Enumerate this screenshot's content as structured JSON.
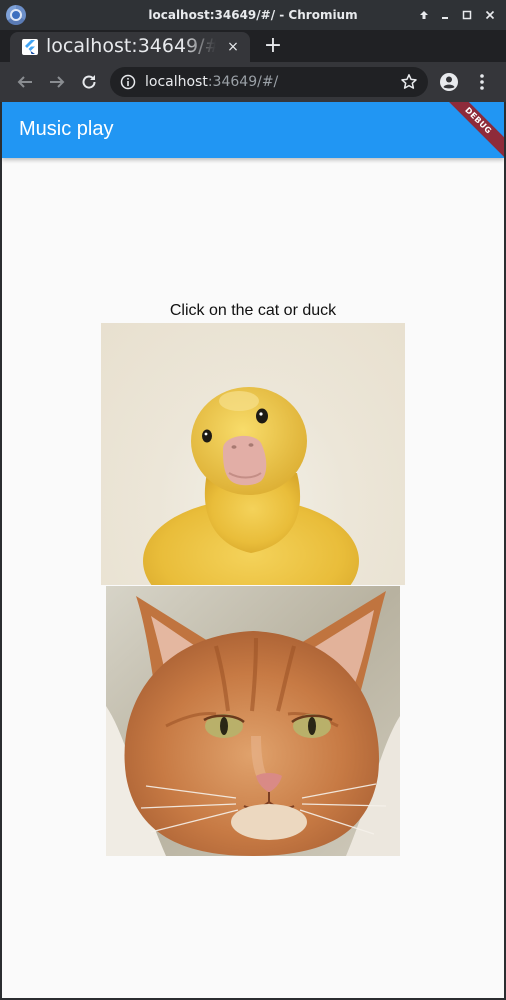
{
  "window": {
    "title": "localhost:34649/#/ - Chromium"
  },
  "tabs": [
    {
      "title": "localhost:34649/#/",
      "close_glyph": "×"
    }
  ],
  "new_tab_glyph": "+",
  "toolbar": {
    "url_host": "localhost",
    "url_path": ":34649/#/"
  },
  "app": {
    "title": "Music play",
    "debug_banner": "DEBUG",
    "prompt": "Click on the cat or duck",
    "accent_color": "#2196f3",
    "debug_color": "#8e2b3a"
  },
  "images": {
    "duck": {
      "subject": "duckling"
    },
    "cat": {
      "subject": "orange tabby cat"
    }
  },
  "icons": {
    "back": "arrow-left-icon",
    "forward": "arrow-right-icon",
    "reload": "reload-icon",
    "info": "info-icon",
    "bookmark": "star-icon",
    "profile": "account-circle-icon",
    "menu": "kebab-menu-icon"
  }
}
